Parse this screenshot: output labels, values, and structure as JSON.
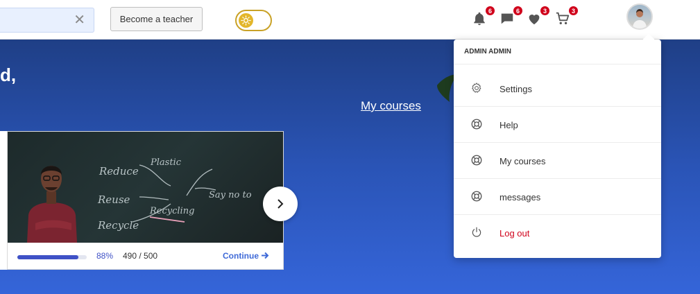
{
  "header": {
    "search": {
      "clear_icon": "close-icon",
      "value": ""
    },
    "become_teacher_label": "Become a teacher",
    "theme_icon": "sun-icon",
    "notifications": {
      "icon": "bell-icon",
      "count": "6"
    },
    "messages": {
      "icon": "chat-icon",
      "count": "6"
    },
    "wishlist": {
      "icon": "heart-icon",
      "count": "3"
    },
    "cart": {
      "icon": "cart-icon",
      "count": "3"
    }
  },
  "hero": {
    "greeting": "d,",
    "my_courses_link": "My courses",
    "course": {
      "progress_fraction": 0.88,
      "progress_percent": "88%",
      "progress_count": "490 / 500",
      "continue_label": "Continue",
      "image_text": [
        "Reduce",
        "Reuse",
        "Recycle",
        "Plastic",
        "Recycling",
        "Say no to"
      ]
    }
  },
  "user_menu": {
    "username": "ADMIN ADMIN",
    "items": [
      {
        "label": "Settings",
        "icon": "gear-icon"
      },
      {
        "label": "Help",
        "icon": "lifebuoy-icon"
      },
      {
        "label": "My courses",
        "icon": "lifebuoy-icon"
      },
      {
        "label": "messages",
        "icon": "lifebuoy-icon"
      },
      {
        "label": "Log out",
        "icon": "power-icon"
      }
    ]
  },
  "colors": {
    "hero_top": "#1f3f86",
    "hero_bottom": "#3565d9",
    "badge": "#d0021b",
    "logout": "#d0021b",
    "highlight": "#f4f600",
    "progress": "#3f51c6",
    "toggle": "#c9a227"
  }
}
